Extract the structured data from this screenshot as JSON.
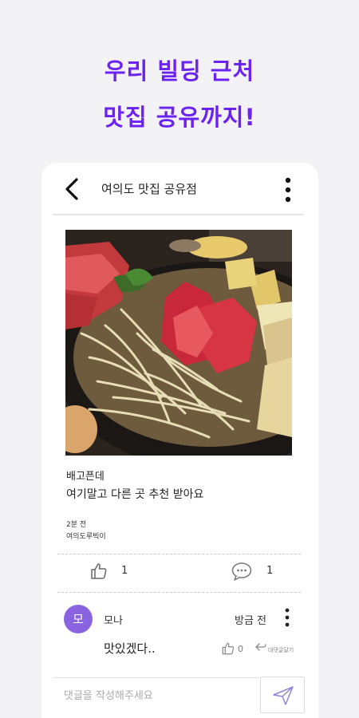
{
  "promo": {
    "line1": "우리 빌딩 근처",
    "line2": "맛집 공유까지!"
  },
  "header": {
    "title": "여의도 맛집 공유점"
  },
  "post": {
    "title": "배고픈데",
    "body": "여기말고 다른 곳 추천 받아요",
    "time": "2분 전",
    "author": "여의도루빅이",
    "likes": "1",
    "comments": "1"
  },
  "comment": {
    "avatar_text": "모",
    "author": "모나",
    "time": "방금 전",
    "text": "맛있겠다..",
    "likes": "0",
    "reply_label": "대댓글달기"
  },
  "input": {
    "placeholder": "댓글을 작성해주세요"
  },
  "colors": {
    "accent": "#6b22f2",
    "avatar": "#8a63e0",
    "background": "#f3f3f5"
  }
}
